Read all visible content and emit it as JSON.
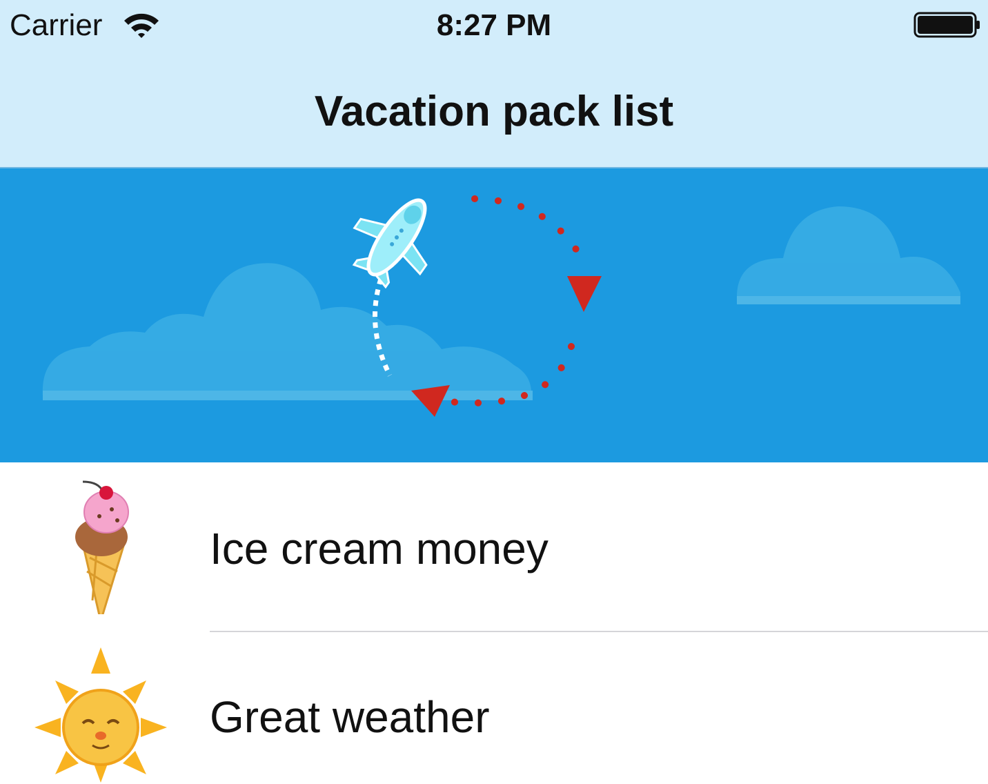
{
  "status_bar": {
    "carrier": "Carrier",
    "time": "8:27 PM",
    "wifi_icon": "wifi-icon",
    "battery_icon": "battery-full-icon"
  },
  "nav_bar": {
    "title": "Vacation pack list"
  },
  "banner": {
    "illustration": "airplane-loop-illustration",
    "background_color": "#1c9ae0"
  },
  "list": {
    "items": [
      {
        "label": "Ice cream money",
        "icon": "ice-cream-icon"
      },
      {
        "label": "Great weather",
        "icon": "sun-icon"
      }
    ]
  },
  "colors": {
    "header_bg": "#d2edfb",
    "banner_bg": "#1c9ae0",
    "arrow_red": "#d0281f"
  }
}
